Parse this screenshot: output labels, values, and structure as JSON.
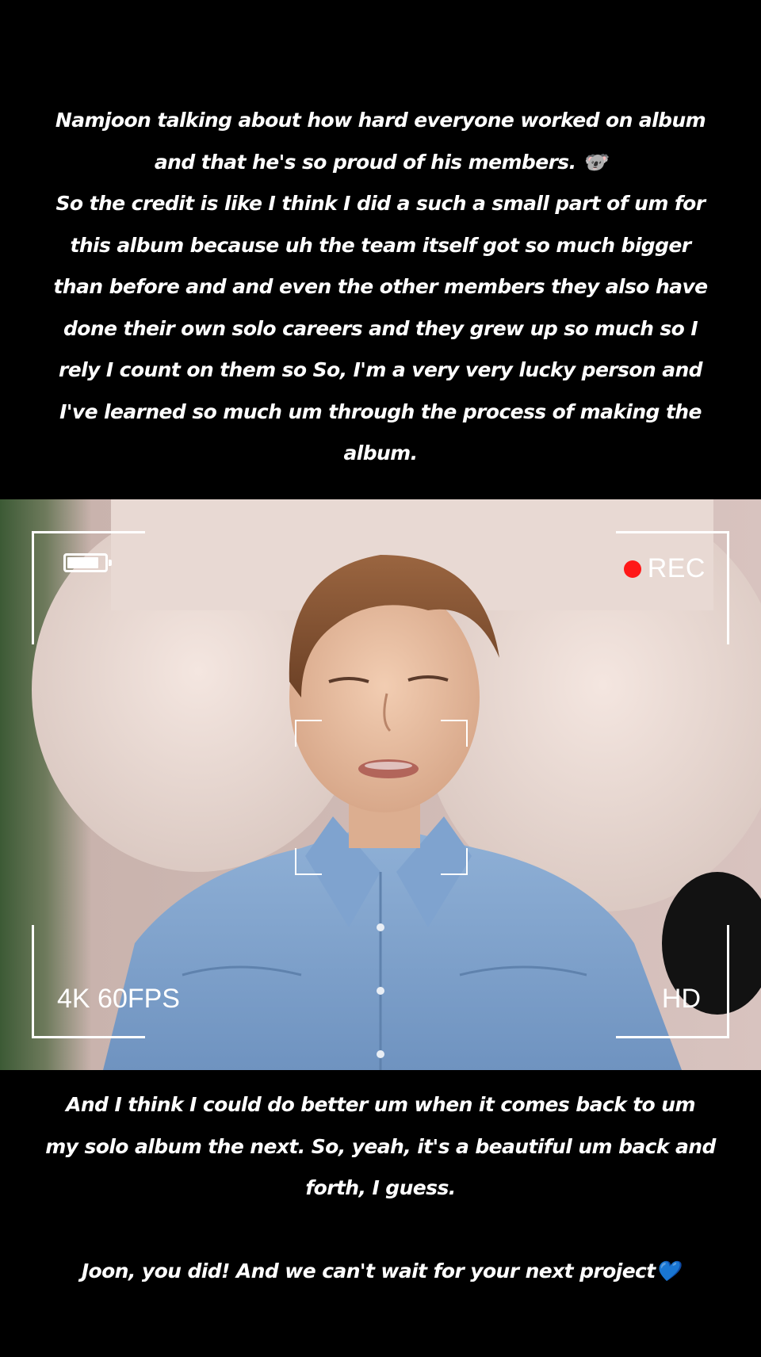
{
  "captions": {
    "top": "Namjoon talking about how hard everyone worked on album\nand that he's so proud of his members. 🐨\nSo the credit is like I think I did a such a small part of um for\nthis album because uh the team itself got so much bigger\nthan before and and even the other members they also have\ndone their own solo careers and they grew up so much so I\nrely I count on them so So, I'm a very very lucky person and\nI've learned so much um through the process of making the\nalbum.",
    "bottom": "And I think I could do better um when it comes back to um\nmy solo album the next. So, yeah, it's a beautiful um back and\nforth, I guess.",
    "closing": "Joon, you did! And we can't wait for your next project💙"
  },
  "camera_overlay": {
    "record_label": "REC",
    "record_dot_color": "#ff1818",
    "resolution_label": "4K 60FPS",
    "quality_label": "HD",
    "battery_level": 0.85,
    "icons": [
      "battery-icon",
      "record-dot-icon",
      "viewfinder-corners",
      "focus-brackets"
    ]
  },
  "video": {
    "subject": "person lying on pillow wearing a light blue denim shirt"
  }
}
